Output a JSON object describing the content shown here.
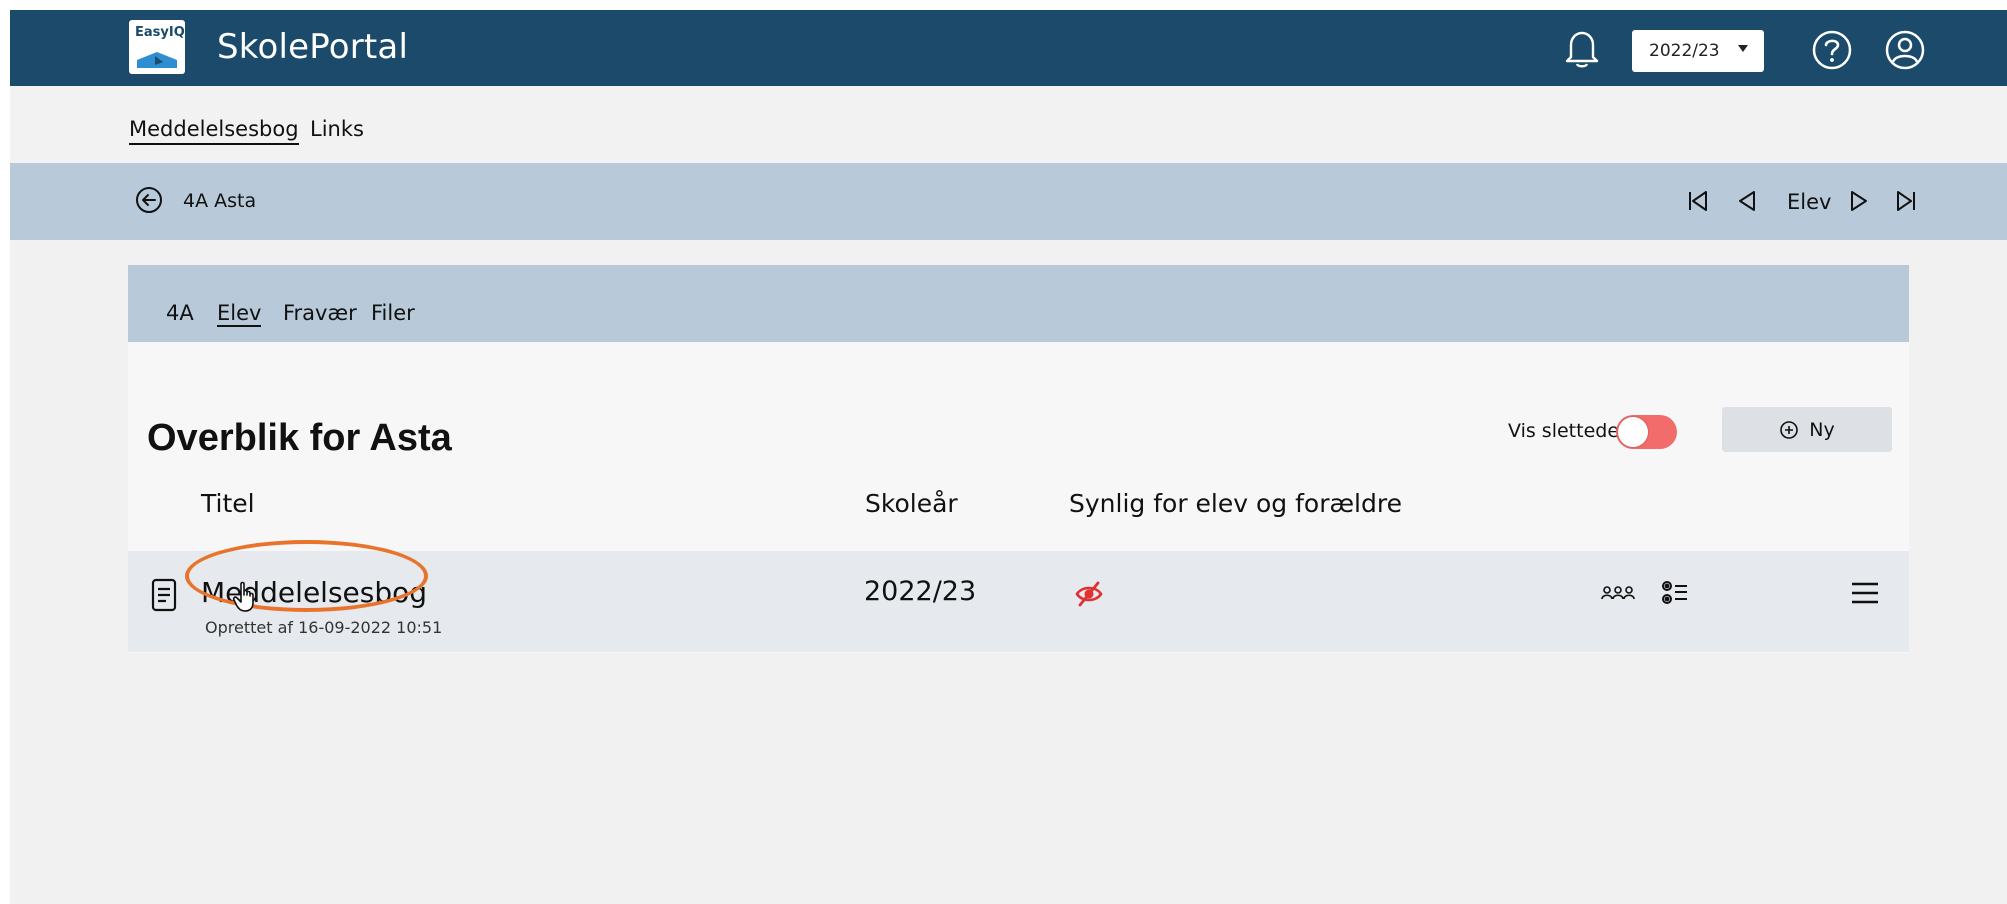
{
  "header": {
    "brand_logo_text": "EasyIQ",
    "app_title": "SkolePortal",
    "year_selector": {
      "value": "2022/23"
    },
    "icons": [
      "bell-icon",
      "help-icon",
      "user-icon"
    ],
    "color": "#1b4a6b"
  },
  "subnav": {
    "items": [
      {
        "label": "Meddelelsesbog",
        "active": true
      },
      {
        "label": "Links",
        "active": false
      }
    ]
  },
  "breadcrumb": {
    "student_label": "4A Asta",
    "nav_label": "Elev"
  },
  "card": {
    "tabs": [
      {
        "label": "4A",
        "active": false
      },
      {
        "label": "Elev",
        "active": true
      },
      {
        "label": "Fravær",
        "active": false
      },
      {
        "label": "Filer",
        "active": false
      }
    ],
    "heading": "Overblik for Asta",
    "show_deleted_label": "Vis slettede",
    "new_button_label": "Ny",
    "columns": {
      "title": "Titel",
      "school_year": "Skoleår",
      "visible": "Synlig for elev og forældre"
    },
    "rows": [
      {
        "title": "Meddelelsesbog",
        "meta_prefix": "Oprettet af",
        "meta_date": "16-09-2022 10:51",
        "school_year": "2022/23",
        "visibility": "hidden"
      }
    ]
  },
  "colors": {
    "header_bg": "#1b4a6b",
    "band_bg": "#b8cad9",
    "toggle_off": "#f36c6c",
    "hidden_eye": "#e03030",
    "highlight": "#e8742c"
  }
}
